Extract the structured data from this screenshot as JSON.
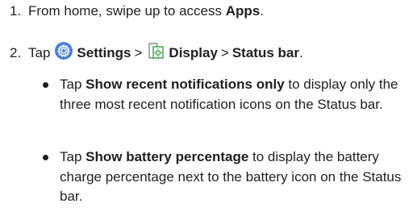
{
  "steps": [
    {
      "number": "1.",
      "prefix": "From home, swipe up to access ",
      "bold": "Apps",
      "suffix": "."
    },
    {
      "number": "2.",
      "prefix": "Tap",
      "settings_label": "Settings",
      "separator": ">",
      "display_label": "Display",
      "status_bar_label": "Status bar",
      "suffix": "."
    }
  ],
  "bullets": [
    {
      "prefix": "Tap ",
      "bold": "Show recent notifications only",
      "suffix": " to display only the three most recent notification icons on the Status bar."
    },
    {
      "prefix": "Tap ",
      "bold": "Show battery percentage",
      "suffix": " to display the battery charge percentage next to the battery icon on the Status bar."
    }
  ],
  "icons": {
    "settings": "settings-gear-icon",
    "display": "display-brightness-icon"
  },
  "colors": {
    "text": "#1f1f1f",
    "settings_icon_bg": "#4a7fd9",
    "display_icon_green": "#3aa34a"
  }
}
